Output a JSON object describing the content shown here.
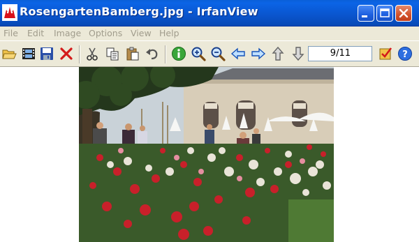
{
  "window": {
    "title": "RosengartenBamberg.jpg - IrfanView",
    "app_icon": "irfanview-cat-icon",
    "controls": [
      "minimize-icon",
      "maximize-icon",
      "close-icon"
    ]
  },
  "menu": {
    "items": [
      "File",
      "Edit",
      "Image",
      "Options",
      "View",
      "Help"
    ]
  },
  "toolbar": {
    "icons": [
      "open-folder-icon",
      "filmstrip-icon",
      "save-icon",
      "delete-icon",
      "cut-icon",
      "copy-icon",
      "paste-icon",
      "undo-icon",
      "info-icon",
      "zoom-in-icon",
      "zoom-out-icon",
      "previous-icon",
      "next-icon",
      "up-icon",
      "down-icon",
      "settings-check-icon",
      "help-icon"
    ],
    "page_counter": "9/11"
  },
  "image": {
    "subject": "photo",
    "description_icon": "rose-garden-photo"
  },
  "colors": {
    "titlebar": "#0a56d0",
    "menubar": "#ece9d8",
    "menu_text_disabled": "#a09c8c",
    "close_button": "#d2512b"
  }
}
